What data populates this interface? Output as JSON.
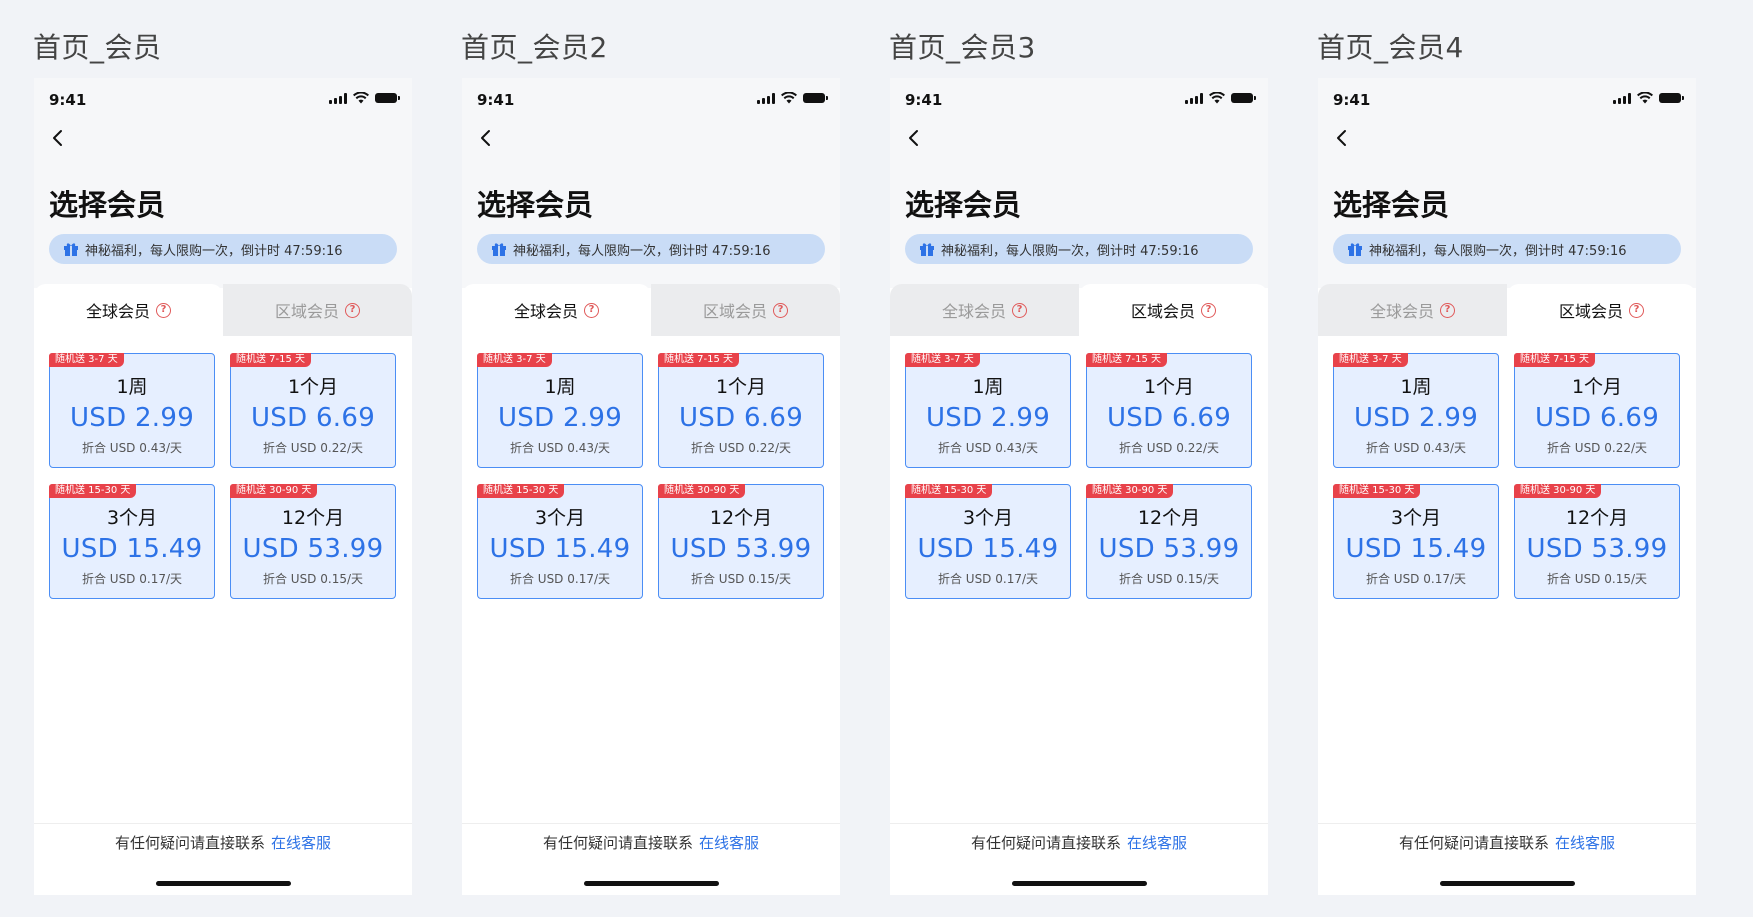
{
  "colors": {
    "accent": "#2d72e6",
    "badge": "#e8424a",
    "card_bg": "#e6efff",
    "card_border": "#4b8ef5",
    "promo_bg": "#c9dcf6"
  },
  "frames": [
    {
      "label": "首页_会员",
      "time": "9:41",
      "title": "选择会员",
      "promo": "神秘福利，每人限购一次，倒计时 47:59:16",
      "tabs": [
        {
          "label": "全球会员",
          "active": true
        },
        {
          "label": "区域会员",
          "active": false
        }
      ],
      "plans": [
        {
          "badge": "随机送 3-7 天",
          "name": "1周",
          "price": "USD 2.99",
          "daily": "折合 USD 0.43/天"
        },
        {
          "badge": "随机送 7-15 天",
          "name": "1个月",
          "price": "USD 6.69",
          "daily": "折合 USD 0.22/天"
        },
        {
          "badge": "随机送 15-30 天",
          "name": "3个月",
          "price": "USD 15.49",
          "daily": "折合 USD 0.17/天"
        },
        {
          "badge": "随机送 30-90 天",
          "name": "12个月",
          "price": "USD 53.99",
          "daily": "折合 USD 0.15/天"
        }
      ],
      "footer": {
        "text": "有任何疑问请直接联系",
        "link": "在线客服"
      }
    },
    {
      "label": "首页_会员2",
      "time": "9:41",
      "title": "选择会员",
      "promo": "神秘福利，每人限购一次，倒计时 47:59:16",
      "tabs": [
        {
          "label": "全球会员",
          "active": true
        },
        {
          "label": "区域会员",
          "active": false
        }
      ],
      "plans": [
        {
          "badge": "随机送 3-7 天",
          "name": "1周",
          "price": "USD 2.99",
          "daily": "折合 USD 0.43/天"
        },
        {
          "badge": "随机送 7-15 天",
          "name": "1个月",
          "price": "USD 6.69",
          "daily": "折合 USD 0.22/天"
        },
        {
          "badge": "随机送 15-30 天",
          "name": "3个月",
          "price": "USD 15.49",
          "daily": "折合 USD 0.17/天"
        },
        {
          "badge": "随机送 30-90 天",
          "name": "12个月",
          "price": "USD 53.99",
          "daily": "折合 USD 0.15/天"
        }
      ],
      "footer": {
        "text": "有任何疑问请直接联系",
        "link": "在线客服"
      }
    },
    {
      "label": "首页_会员3",
      "time": "9:41",
      "title": "选择会员",
      "promo": "神秘福利，每人限购一次，倒计时 47:59:16",
      "tabs": [
        {
          "label": "全球会员",
          "active": false
        },
        {
          "label": "区域会员",
          "active": true
        }
      ],
      "plans": [
        {
          "badge": "随机送 3-7 天",
          "name": "1周",
          "price": "USD 2.99",
          "daily": "折合 USD 0.43/天"
        },
        {
          "badge": "随机送 7-15 天",
          "name": "1个月",
          "price": "USD 6.69",
          "daily": "折合 USD 0.22/天"
        },
        {
          "badge": "随机送 15-30 天",
          "name": "3个月",
          "price": "USD 15.49",
          "daily": "折合 USD 0.17/天"
        },
        {
          "badge": "随机送 30-90 天",
          "name": "12个月",
          "price": "USD 53.99",
          "daily": "折合 USD 0.15/天"
        }
      ],
      "footer": {
        "text": "有任何疑问请直接联系",
        "link": "在线客服"
      }
    },
    {
      "label": "首页_会员4",
      "time": "9:41",
      "title": "选择会员",
      "promo": "神秘福利，每人限购一次，倒计时 47:59:16",
      "tabs": [
        {
          "label": "全球会员",
          "active": false
        },
        {
          "label": "区域会员",
          "active": true
        }
      ],
      "plans": [
        {
          "badge": "随机送 3-7 天",
          "name": "1周",
          "price": "USD 2.99",
          "daily": "折合 USD 0.43/天"
        },
        {
          "badge": "随机送 7-15 天",
          "name": "1个月",
          "price": "USD 6.69",
          "daily": "折合 USD 0.22/天"
        },
        {
          "badge": "随机送 15-30 天",
          "name": "3个月",
          "price": "USD 15.49",
          "daily": "折合 USD 0.17/天"
        },
        {
          "badge": "随机送 30-90 天",
          "name": "12个月",
          "price": "USD 53.99",
          "daily": "折合 USD 0.15/天"
        }
      ],
      "footer": {
        "text": "有任何疑问请直接联系",
        "link": "在线客服"
      }
    }
  ]
}
